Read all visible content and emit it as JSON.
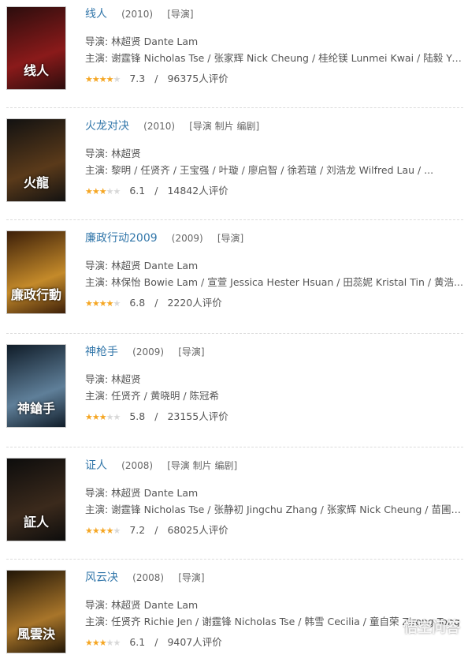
{
  "movies": [
    {
      "title": "线人",
      "year": "(2010)",
      "roles": "[导演]",
      "director": "导演: 林超贤 Dante Lam",
      "cast": "主演: 谢霆锋 Nicholas Tse / 张家辉 Nick Cheung / 桂纶镁 Lunmei Kwai / 陆毅 Yi ...",
      "rating": 7.3,
      "rating_text": "7.3",
      "count": "96375人评价",
      "poster_text": "线人",
      "poster_colors": [
        "#2a0d0d",
        "#8a1a1a"
      ]
    },
    {
      "title": "火龙对决",
      "year": "(2010)",
      "roles": "[导演 制片 编剧]",
      "director": "导演: 林超贤",
      "cast": "主演: 黎明 / 任贤齐 / 王宝强 / 叶璇 / 廖启智 / 徐若瑄 / 刘浩龙 Wilfred Lau / ...",
      "rating": 6.1,
      "rating_text": "6.1",
      "count": "14842人评价",
      "poster_text": "火龍",
      "poster_colors": [
        "#111111",
        "#5a3a1a"
      ]
    },
    {
      "title": "廉政行动2009",
      "year": "(2009)",
      "roles": "[导演]",
      "director": "导演: 林超贤 Dante Lam",
      "cast": "主演: 林保怡 Bowie Lam / 宣萱 Jessica Hester Hsuan / 田蕊妮 Kristal Tin / 黄浩...",
      "rating": 6.8,
      "rating_text": "6.8",
      "count": "2220人评价",
      "poster_text": "廉政行動",
      "poster_colors": [
        "#3a1d08",
        "#c48a2a"
      ]
    },
    {
      "title": "神枪手",
      "year": "(2009)",
      "roles": "[导演]",
      "director": "导演: 林超贤",
      "cast": "主演: 任贤齐 / 黄晓明 / 陈冠希",
      "rating": 5.8,
      "rating_text": "5.8",
      "count": "23155人评价",
      "poster_text": "神鎗手",
      "poster_colors": [
        "#0e1a26",
        "#5f7f99"
      ]
    },
    {
      "title": "证人",
      "year": "(2008)",
      "roles": "[导演 制片 编剧]",
      "director": "导演: 林超贤 Dante Lam",
      "cast": "主演: 谢霆锋 Nicholas Tse / 张静初 Jingchu Zhang / 张家辉 Nick Cheung / 苗圃 P...",
      "rating": 7.2,
      "rating_text": "7.2",
      "count": "68025人评价",
      "poster_text": "証人",
      "poster_colors": [
        "#0c0c0c",
        "#3b2a1c"
      ]
    },
    {
      "title": "风云决",
      "year": "(2008)",
      "roles": "[导演]",
      "director": "导演: 林超贤 Dante Lam",
      "cast": "主演: 任贤齐 Richie Jen / 谢霆锋 Nicholas Tse / 韩雪 Cecilia / 童自荣 Zirong Tong",
      "rating": 6.1,
      "rating_text": "6.1",
      "count": "9407人评价",
      "poster_text": "風雲決",
      "poster_colors": [
        "#1f1406",
        "#a8752a"
      ]
    }
  ],
  "separator": "/",
  "watermark": "悟空问答"
}
